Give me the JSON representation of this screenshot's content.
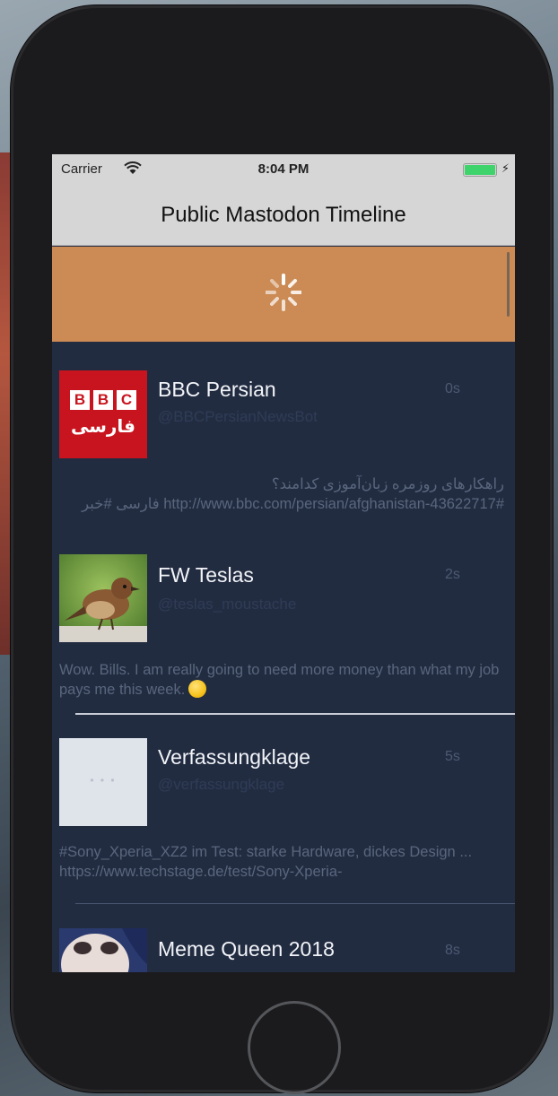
{
  "status_bar": {
    "carrier": "Carrier",
    "time": "8:04 PM"
  },
  "nav": {
    "title": "Public Mastodon Timeline"
  },
  "refresh": {
    "icon": "spinner-icon",
    "banner_color": "#cc8b55"
  },
  "colors": {
    "timeline_background": "#222c41",
    "name_text": "#f2f4f8",
    "body_text": "#59667d"
  },
  "posts": [
    {
      "display_name": "BBC Persian",
      "handle": "@BBCPersianNewsBot",
      "age": "0s",
      "content": "راهکارهای روزمره زبان‌آموزی کدامند؟http://www.bbc.com/persian/afghanistan-43622717# فارسی #خبر",
      "avatar": "bbc-persian-logo",
      "avatar_letters": [
        "B",
        "B",
        "C"
      ],
      "avatar_caption": "فارسی"
    },
    {
      "display_name": "FW Teslas",
      "handle": "@teslas_moustache",
      "age": "2s",
      "content": "Wow. Bills. I am really going to need more money than what my job pays me this week.",
      "avatar": "bird-photo"
    },
    {
      "display_name": "Verfassungklage",
      "handle": "@verfassungklage",
      "age": "5s",
      "content": "#Sony_Xperia_XZ2 im Test: starke Hardware, dickes Design ... https://www.techstage.de/test/Sony-Xperia-",
      "avatar": "blank-avatar"
    },
    {
      "display_name": "Meme Queen 2018",
      "age": "8s",
      "avatar": "meme-photo"
    }
  ]
}
